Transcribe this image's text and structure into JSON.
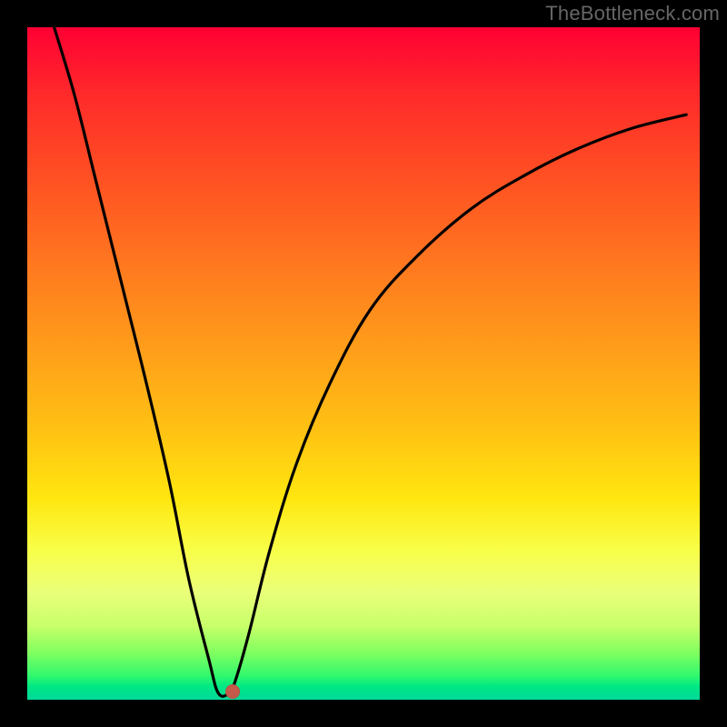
{
  "watermark": "TheBottleneck.com",
  "chart_data": {
    "type": "line",
    "title": "",
    "xlabel": "",
    "ylabel": "",
    "xlim": [
      0,
      100
    ],
    "ylim": [
      0,
      100
    ],
    "grid": false,
    "legend": false,
    "series": [
      {
        "name": "bottleneck-curve",
        "x": [
          4,
          7,
          10,
          13,
          17,
          21,
          24,
          27,
          28.4,
          30,
          31,
          33,
          36,
          40,
          45,
          51,
          58,
          66,
          74,
          82,
          90,
          98
        ],
        "values": [
          100,
          90,
          78,
          66,
          50,
          33,
          18,
          6,
          1,
          1,
          3,
          10,
          22,
          35,
          47,
          58,
          66,
          73,
          78,
          82,
          85,
          87
        ]
      }
    ],
    "marker": {
      "name": "optimal-point",
      "x": 30.5,
      "y": 1.2,
      "color": "#c55a4a"
    },
    "background_gradient": {
      "top": "#ff0033",
      "bottom": "#00d89a",
      "stops": [
        "#ff0033",
        "#ff7a1f",
        "#ffc213",
        "#f8ff4a",
        "#30f86e",
        "#00d89a"
      ]
    },
    "frame_color": "#000000",
    "curve_color": "#000000"
  }
}
